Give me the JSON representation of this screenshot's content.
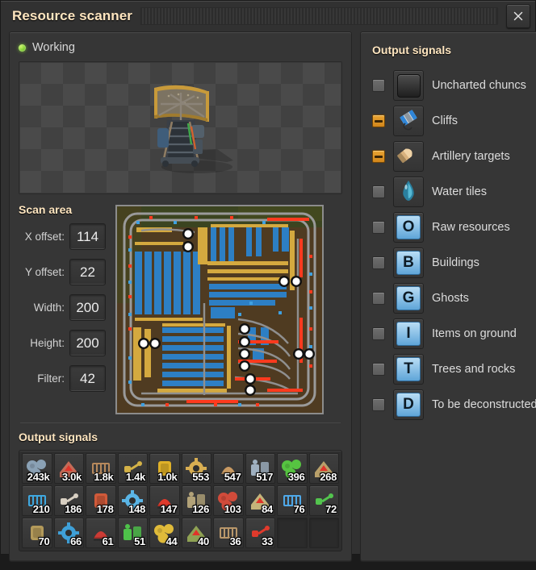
{
  "window": {
    "title": "Resource scanner",
    "close_label": "✕",
    "close_icon": "close-icon",
    "drag_handle": "window-drag-handle"
  },
  "status": {
    "label": "Working",
    "led_color": "#8cdc3c",
    "led_icon": "status-led-icon"
  },
  "preview": {
    "entity": "radar",
    "icon": "radar-entity-icon"
  },
  "scan_area": {
    "title": "Scan area",
    "fields": [
      {
        "label": "X offset:",
        "value": "114",
        "name": "x-offset"
      },
      {
        "label": "Y offset:",
        "value": "22",
        "name": "y-offset"
      },
      {
        "label": "Width:",
        "value": "200",
        "name": "width"
      },
      {
        "label": "Height:",
        "value": "200",
        "name": "height"
      },
      {
        "label": "Filter:",
        "value": "42",
        "name": "filter"
      }
    ]
  },
  "minimap": {
    "name": "factory-minimap",
    "terrain_color": "#4f3b21",
    "grass_color": "#3c4520",
    "rail_color": "#9a9a9a",
    "belt_color": "#c8a04d",
    "building_color": "#2d7fc4",
    "alert_color": "#ff3a1e",
    "train_marker_count": 13
  },
  "bottom_signals": {
    "title": "Output signals",
    "columns": 10,
    "slots": [
      {
        "count": "243k",
        "icon": "stone-icon",
        "color": "#8aa1b5"
      },
      {
        "count": "3.0k",
        "icon": "assembling-machine-3-icon",
        "color": "#c46b57"
      },
      {
        "count": "1.8k",
        "icon": "assembling-machine-2-icon",
        "color": "#b7895c"
      },
      {
        "count": "1.4k",
        "icon": "electric-pole-icon",
        "color": "#d4b247"
      },
      {
        "count": "1.0k",
        "icon": "inserter-icon",
        "color": "#e0b128"
      },
      {
        "count": "553",
        "icon": "small-electric-pole-icon",
        "color": "#d8ae52"
      },
      {
        "count": "547",
        "icon": "assembling-machine-1-icon",
        "color": "#c99a62"
      },
      {
        "count": "517",
        "icon": "chemical-plant-icon",
        "color": "#9fb0c0"
      },
      {
        "count": "396",
        "icon": "fast-inserter-icon",
        "color": "#56c441"
      },
      {
        "count": "268",
        "icon": "gear-wheel-icon",
        "color": "#b9a06a"
      },
      {
        "count": "210",
        "icon": "long-inserter-icon",
        "color": "#3fa8e0"
      },
      {
        "count": "186",
        "icon": "steel-chest-icon",
        "color": "#d8cfc2"
      },
      {
        "count": "178",
        "icon": "transport-belt-icon",
        "color": "#d05a3a"
      },
      {
        "count": "148",
        "icon": "splitter-icon",
        "color": "#5ab5e6"
      },
      {
        "count": "147",
        "icon": "fast-belt-icon",
        "color": "#e03a2c"
      },
      {
        "count": "126",
        "icon": "pipe-icon",
        "color": "#b2a278"
      },
      {
        "count": "103",
        "icon": "underground-belt-icon",
        "color": "#d14b3a"
      },
      {
        "count": "84",
        "icon": "storage-tank-icon",
        "color": "#c5b47a"
      },
      {
        "count": "76",
        "icon": "substation-icon",
        "color": "#4fa8e8"
      },
      {
        "count": "72",
        "icon": "programmable-speaker-icon",
        "color": "#53c44e"
      },
      {
        "count": "70",
        "icon": "boiler-icon",
        "color": "#b39a5a"
      },
      {
        "count": "66",
        "icon": "blue-chest-icon",
        "color": "#3fa0d8"
      },
      {
        "count": "61",
        "icon": "red-assembler-icon",
        "color": "#cc3b35"
      },
      {
        "count": "51",
        "icon": "rail-signal-icon",
        "color": "#4ec24a"
      },
      {
        "count": "44",
        "icon": "pump-icon",
        "color": "#e0bb3a"
      },
      {
        "count": "40",
        "icon": "gear-panel-icon",
        "color": "#8fa254"
      },
      {
        "count": "36",
        "icon": "pumpjack-icon",
        "color": "#b9976a"
      },
      {
        "count": "33",
        "icon": "rail-chain-signal-icon",
        "color": "#e03a2c"
      },
      {
        "count": "",
        "icon": "empty-slot",
        "color": ""
      },
      {
        "count": "",
        "icon": "empty-slot",
        "color": ""
      }
    ]
  },
  "output_signals": {
    "title": "Output signals",
    "rows": [
      {
        "label": "Uncharted chuncs",
        "checkbox": "off",
        "icon": "dark-tile-icon",
        "tile": "dark",
        "letter": ""
      },
      {
        "label": "Cliffs",
        "checkbox": "indeterminate",
        "icon": "cliff-explosives-icon",
        "tile": "image",
        "letter": ""
      },
      {
        "label": "Artillery targets",
        "checkbox": "indeterminate",
        "icon": "artillery-shell-icon",
        "tile": "image",
        "letter": ""
      },
      {
        "label": "Water tiles",
        "checkbox": "off",
        "icon": "water-droplet-icon",
        "tile": "image",
        "letter": ""
      },
      {
        "label": "Raw resources",
        "checkbox": "off",
        "icon": "signal-o-icon",
        "tile": "letter",
        "letter": "O"
      },
      {
        "label": "Buildings",
        "checkbox": "off",
        "icon": "signal-b-icon",
        "tile": "letter",
        "letter": "B"
      },
      {
        "label": "Ghosts",
        "checkbox": "off",
        "icon": "signal-g-icon",
        "tile": "letter",
        "letter": "G"
      },
      {
        "label": "Items on ground",
        "checkbox": "off",
        "icon": "signal-i-icon",
        "tile": "letter",
        "letter": "I"
      },
      {
        "label": "Trees and rocks",
        "checkbox": "off",
        "icon": "signal-t-icon",
        "tile": "letter",
        "letter": "T"
      },
      {
        "label": "To be deconstructed",
        "checkbox": "off",
        "icon": "signal-d-icon",
        "tile": "letter",
        "letter": "D"
      }
    ]
  },
  "colors": {
    "accent": "#ffe6c0",
    "panel": "#363636",
    "window": "#313131",
    "checkbox_on": "#e8a433",
    "led": "#8cdc3c"
  }
}
